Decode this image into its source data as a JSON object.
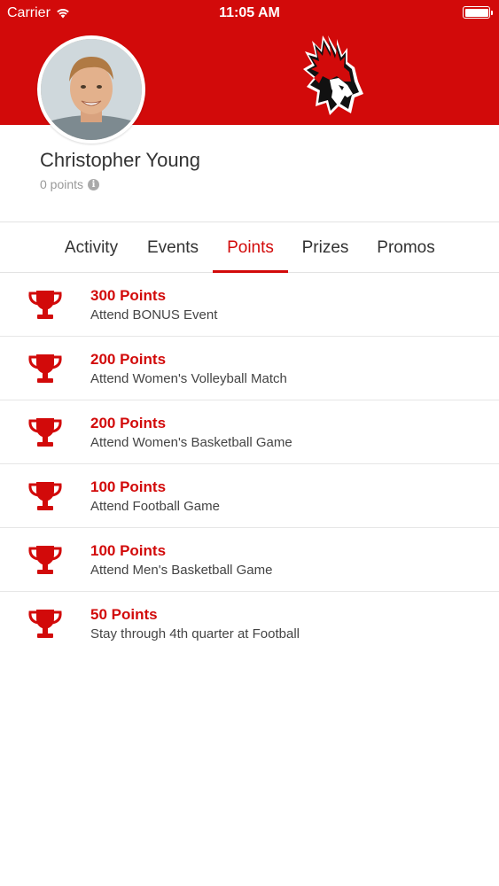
{
  "status_bar": {
    "carrier": "Carrier",
    "time": "11:05 AM"
  },
  "profile": {
    "name": "Christopher Young",
    "points_text": "0 points"
  },
  "tabs": [
    {
      "label": "Activity"
    },
    {
      "label": "Events"
    },
    {
      "label": "Points",
      "active": true
    },
    {
      "label": "Prizes"
    },
    {
      "label": "Promos"
    }
  ],
  "points": [
    {
      "title": "300 Points",
      "description": "Attend BONUS Event"
    },
    {
      "title": "200 Points",
      "description": "Attend Women's Volleyball Match"
    },
    {
      "title": "200 Points",
      "description": "Attend Women's Basketball Game"
    },
    {
      "title": "100 Points",
      "description": "Attend Football Game"
    },
    {
      "title": "100 Points",
      "description": "Attend Men's Basketball Game"
    },
    {
      "title": "50 Points",
      "description": "Stay through 4th quarter at Football"
    }
  ],
  "icons": {
    "wifi": "wifi-icon",
    "battery": "battery-icon",
    "info": "info-icon",
    "trophy": "trophy-icon",
    "logo": "cardinal-logo"
  },
  "colors": {
    "brand": "#d20a0a",
    "text": "#333333",
    "muted": "#999999",
    "divider": "#e6e6e6"
  }
}
